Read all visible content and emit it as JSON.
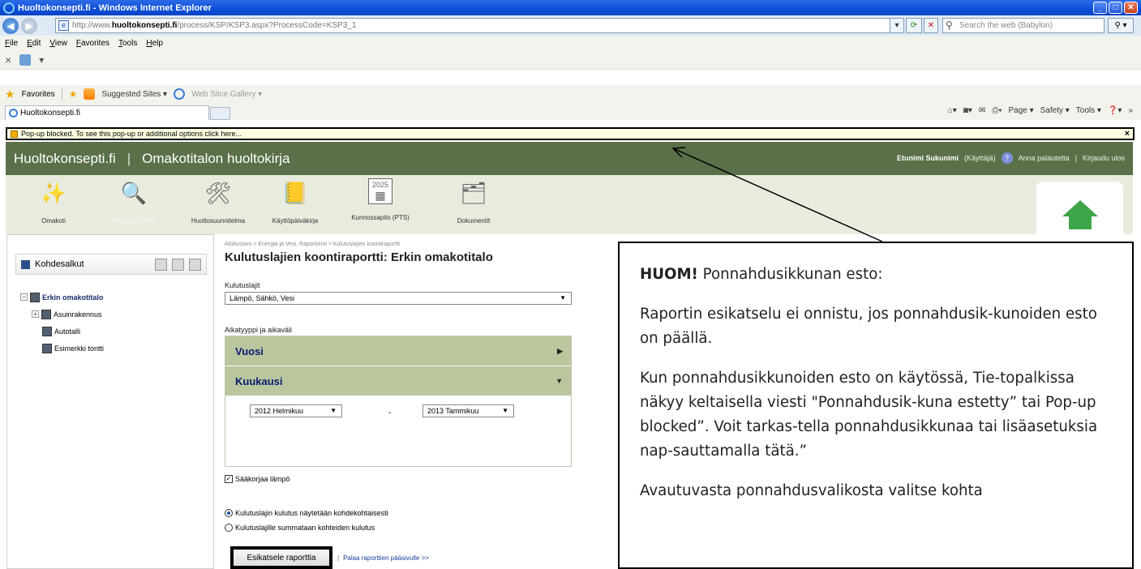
{
  "browser": {
    "window_title": "Huoltokonsepti.fi - Windows Internet Explorer",
    "url_prefix": "http://www.",
    "url_domain": "huoltokonsepti.fi",
    "url_rest": "/process/KSP/KSP3.aspx?ProcessCode=KSP3_1",
    "search_placeholder": "Search the web (Babylon)",
    "menu": [
      "File",
      "Edit",
      "View",
      "Favorites",
      "Tools",
      "Help"
    ],
    "favorites_label": "Favorites",
    "favorites_links": [
      "Suggested Sites ▾",
      "Web Slice Gallery ▾"
    ],
    "tab_title": "Huoltokonsepti.fi",
    "tools": [
      "Page ▾",
      "Safety ▾",
      "Tools ▾"
    ],
    "infobar_text": "Pop-up blocked. To see this pop-up or additional options click here...",
    "infobar_close": "×"
  },
  "site": {
    "brand": "Huoltokonsepti.fi",
    "separator": "|",
    "section_title": "Omakotitalon huoltokirja",
    "user_name": "Etunimi Sukunimi",
    "user_role": "(Käyttäjä)",
    "feedback": "Anna palautetta",
    "logout": "Kirjaudu ulos",
    "user_sep": "|",
    "nav": [
      {
        "label": "Omakoti",
        "icon": "sparkle-tools-icon"
      },
      {
        "label": "Energia ja Vesi",
        "icon": "magnifier-chart-icon"
      },
      {
        "label": "Huoltosuunnitelma",
        "icon": "wrench-screwdriver-icon"
      },
      {
        "label": "Käyttöpäiväkirja",
        "icon": "logbook-icon"
      },
      {
        "label": "Kunnossapito (PTS)",
        "icon": "calendar-icon",
        "badge": "2025"
      },
      {
        "label": "Dokumentit",
        "icon": "folder-icon"
      }
    ]
  },
  "sidebar": {
    "title": "Kohdesalkut",
    "tree": [
      {
        "label": "Erkin omakotitalo",
        "level": 0
      },
      {
        "label": "Asuinrakennus",
        "level": 1
      },
      {
        "label": "Autotalli",
        "level": 1
      },
      {
        "label": "Esimerkki tontti",
        "level": 1
      }
    ]
  },
  "main": {
    "breadcrumb": "Aloitussivu > Energia ja Vesi, Raportointi > Kulutuslajien koontiraportti",
    "title": "Kulutuslajien koontiraportti: Erkin omakotitalo",
    "kulutuslajit_label": "Kulutuslajit",
    "kulutuslajit_value": "Lämpö, Sähkö, Vesi",
    "aikatyyppi_label": "Aikatyyppi ja aikaväli",
    "acc_vuosi": "Vuosi",
    "acc_kuukausi": "Kuukausi",
    "from_month": "2012 Helmikuu",
    "to_month": "2013 Tammikuu",
    "range_dash": "-",
    "saakorjaa_label": "Sääkorjaa lämpö",
    "saakorjaa_checked": true,
    "radio_1": "Kulutuslajin kulutus näytetään kohdekohtaisesti",
    "radio_2": "Kulutuslajille summataan kohteiden kulutus",
    "preview_button": "Esikatsele raporttia",
    "back_link": "Palaa raporttien pääsivulle >>"
  },
  "callout": {
    "heading_bold": "HUOM!",
    "heading_rest": " Ponnahdusikkunan esto:",
    "p1": "Raportin esikatselu ei onnistu, jos ponnahdusik-kunoiden esto on päällä.",
    "p2": "Kun ponnahdusikkunoiden esto on käytössä, Tie-topalkissa näkyy keltaisella viesti \"Ponnahdusik-kuna estetty” tai Pop-up blocked”. Voit tarkas-tella ponnahdusikkunaa tai lisäasetuksia nap-sauttamalla tätä.”",
    "p3": "Avautuvasta ponnahdusvalikosta valitse kohta"
  },
  "colors": {
    "header_green": "#5b7048",
    "nav_bg": "#e8ecdf",
    "accordion_green": "#b9c69e",
    "accordion_text": "#0d1a72",
    "infobar_yellow": "#ffffe1"
  }
}
